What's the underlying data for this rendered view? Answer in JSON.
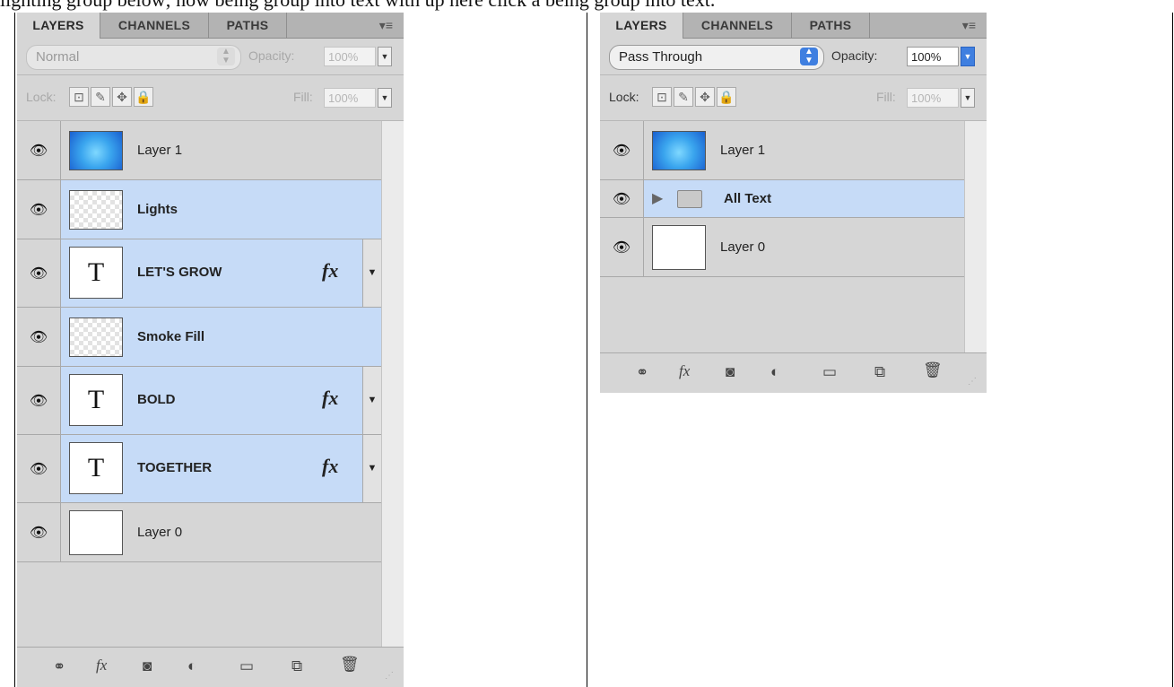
{
  "caption": "lighting group below; now being group into text with up here click a being group into text.",
  "tabs": [
    "LAYERS",
    "CHANNELS",
    "PATHS"
  ],
  "panel_menu_icon": "panel-menu-icon",
  "left_panel": {
    "blend_mode": "Normal",
    "opacity_label": "Opacity:",
    "opacity_value": "100%",
    "lock_label": "Lock:",
    "fill_label": "Fill:",
    "fill_value": "100%",
    "layers": [
      {
        "name": "Layer 1",
        "thumb": "gradient",
        "selected": false,
        "bold": false,
        "fx": false
      },
      {
        "name": "Lights",
        "thumb": "checker",
        "selected": true,
        "bold": true,
        "fx": false
      },
      {
        "name": "LET'S GROW",
        "thumb": "text",
        "selected": true,
        "bold": true,
        "fx": true
      },
      {
        "name": "Smoke Fill",
        "thumb": "checker",
        "selected": true,
        "bold": true,
        "fx": false
      },
      {
        "name": "BOLD",
        "thumb": "text",
        "selected": true,
        "bold": true,
        "fx": true
      },
      {
        "name": "TOGETHER",
        "thumb": "text",
        "selected": true,
        "bold": true,
        "fx": true
      },
      {
        "name": "Layer 0",
        "thumb": "white",
        "selected": false,
        "bold": false,
        "fx": false
      }
    ],
    "text_thumb_glyph": "T",
    "fx_label": "fx"
  },
  "right_panel": {
    "blend_mode": "Pass Through",
    "opacity_label": "Opacity:",
    "opacity_value": "100%",
    "lock_label": "Lock:",
    "fill_label": "Fill:",
    "fill_value": "100%",
    "layers": [
      {
        "name": "Layer 1",
        "thumb": "gradient",
        "selected": false,
        "bold": false
      },
      {
        "name": "All Text",
        "thumb": "group",
        "selected": true,
        "bold": true
      },
      {
        "name": "Layer 0",
        "thumb": "white",
        "selected": false,
        "bold": false
      }
    ]
  },
  "bottom_icons": [
    "link-layers-icon",
    "fx-icon",
    "add-mask-icon",
    "adjustment-layer-icon",
    "new-group-icon",
    "new-layer-icon",
    "delete-layer-icon"
  ],
  "colors": {
    "selected_row": "#c6dbf7",
    "panel_bg": "#d6d6d6",
    "accent": "#3f7fe0"
  }
}
